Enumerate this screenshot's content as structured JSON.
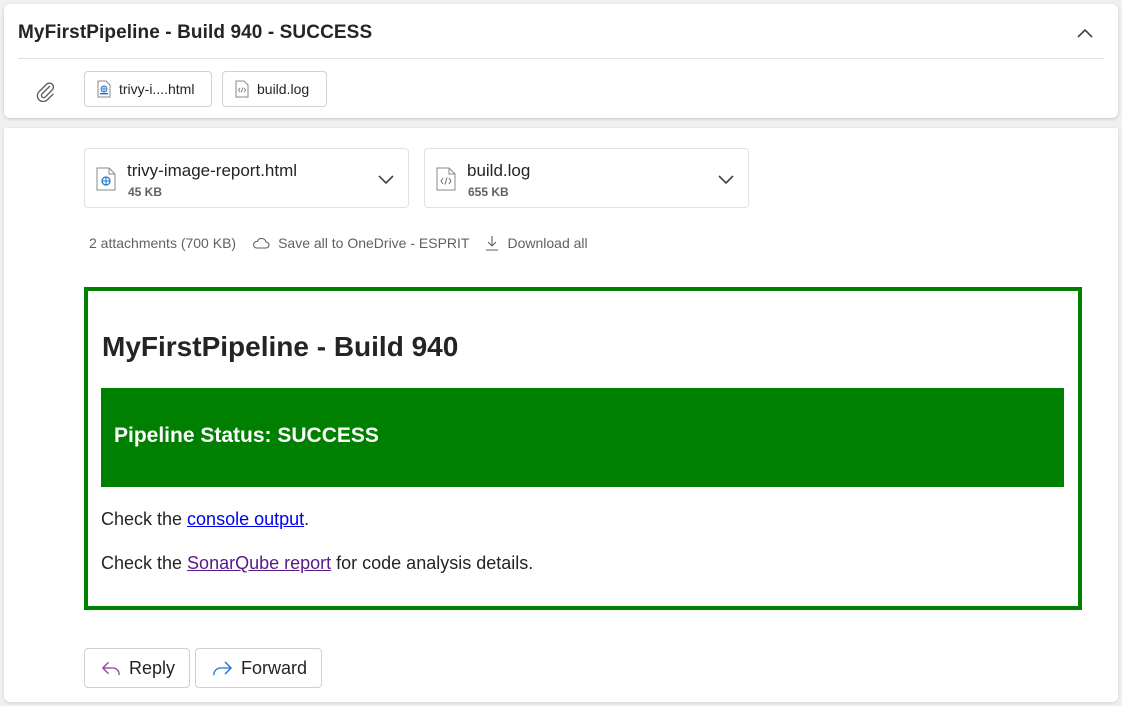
{
  "header": {
    "title": "MyFirstPipeline - Build 940 - SUCCESS",
    "chips": [
      {
        "label": "trivy-i....html",
        "icon": "html-file-icon"
      },
      {
        "label": "build.log",
        "icon": "code-file-icon"
      }
    ]
  },
  "attachments": [
    {
      "name": "trivy-image-report.html",
      "size": "45 KB",
      "icon": "html-file-icon"
    },
    {
      "name": "build.log",
      "size": "655 KB",
      "icon": "code-file-icon"
    }
  ],
  "attachment_meta": {
    "summary": "2 attachments (700 KB)",
    "save_label": "Save all to OneDrive - ESPRIT",
    "download_label": "Download all"
  },
  "mail": {
    "heading": "MyFirstPipeline - Build 940",
    "status": "Pipeline Status: SUCCESS",
    "line1_prefix": "Check the ",
    "line1_link": "console output",
    "line1_suffix": ".",
    "line2_prefix": "Check the ",
    "line2_link": "SonarQube report",
    "line2_suffix": " for code analysis details."
  },
  "actions": {
    "reply": "Reply",
    "forward": "Forward"
  },
  "colors": {
    "success_green": "#008000",
    "link_blue": "#0000ee",
    "link_visited": "#551a8b",
    "reply_purple": "#8a3d9e",
    "forward_blue": "#1a73c7"
  }
}
